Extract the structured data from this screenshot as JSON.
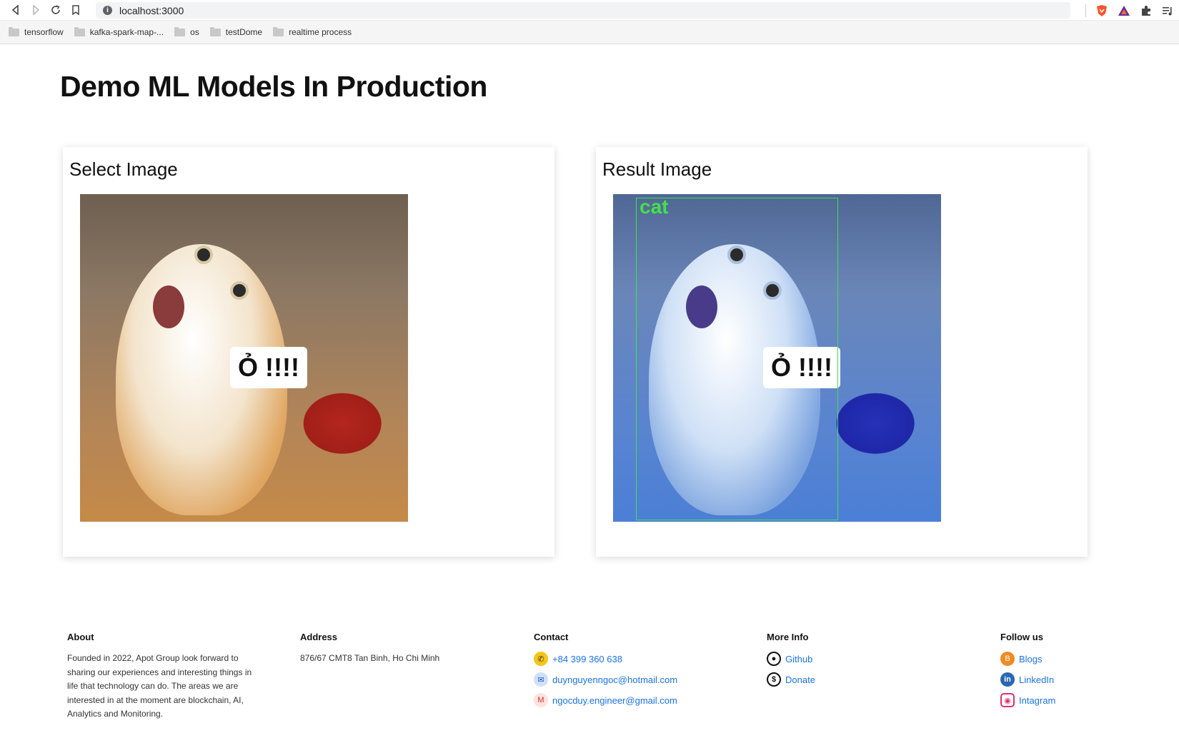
{
  "browser": {
    "url": "localhost:3000",
    "bookmarks": [
      "tensorflow",
      "kafka-spark-map-...",
      "os",
      "testDome",
      "realtime process"
    ]
  },
  "page": {
    "title": "Demo ML Models In Production"
  },
  "select_card": {
    "title": "Select Image",
    "speech_text": "Ỏ !!!!"
  },
  "result_card": {
    "title": "Result Image",
    "speech_text": "Ỏ !!!!",
    "detection_label": "cat",
    "box_color": "#45e04a"
  },
  "footer": {
    "about": {
      "heading": "About",
      "text": "Founded in 2022, Apot Group look forward to sharing our experiences and interesting things in life that technology can do. The areas we are interested in at the moment are blockchain, AI, Analytics and Monitoring."
    },
    "address": {
      "heading": "Address",
      "text": "876/67 CMT8 Tan Binh, Ho Chi Minh"
    },
    "contact": {
      "heading": "Contact",
      "phone": "+84 399 360 638",
      "email1": "duynguyenngoc@hotmail.com",
      "email2": "ngocduy.engineer@gmail.com"
    },
    "more_info": {
      "heading": "More Info",
      "github": "Github",
      "donate": "Donate"
    },
    "follow": {
      "heading": "Follow us",
      "blogs": "Blogs",
      "linkedin": "LinkedIn",
      "instagram": "Intagram"
    }
  },
  "colors": {
    "link": "#1a73e8",
    "blogs_icon": "#f08a24",
    "linkedin_icon": "#2867b2",
    "instagram_icon": "#e1306c"
  }
}
